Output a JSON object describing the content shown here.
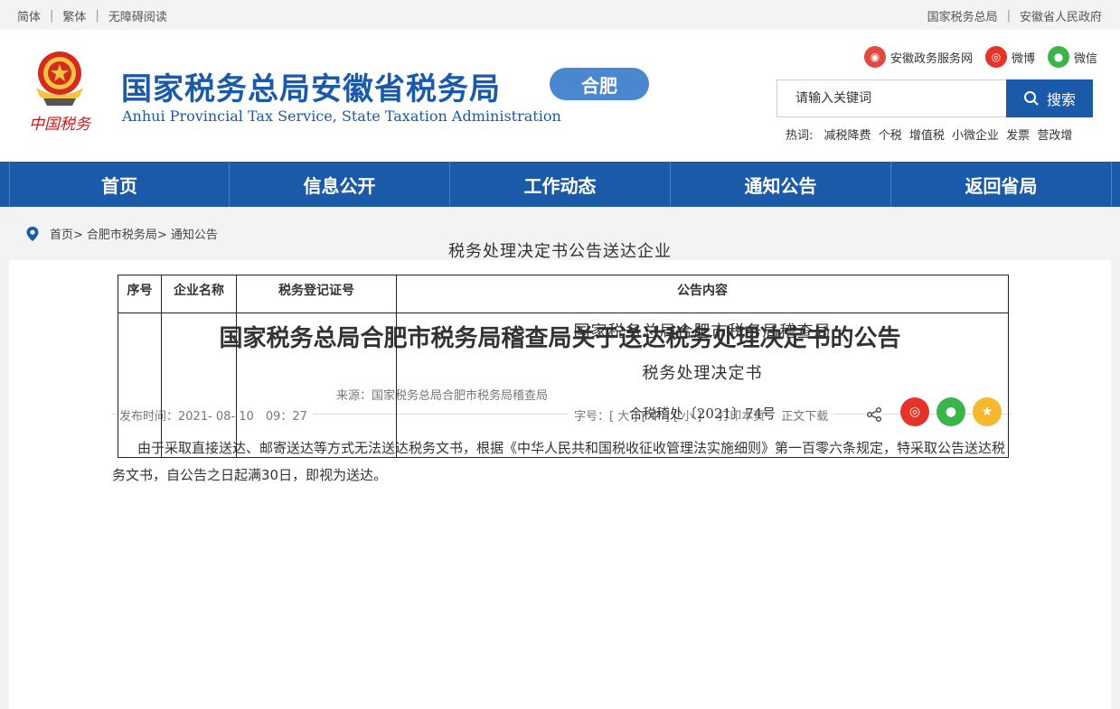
{
  "topbar": {
    "left": [
      "简体",
      "繁体",
      "无障碍阅读"
    ],
    "right": [
      "国家税务总局",
      "安徽省人民政府"
    ]
  },
  "header": {
    "logo_text": "中国税务",
    "site_name_cn": "国家税务总局安徽省税务局",
    "site_name_en": "Anhui Provincial Tax Service, State Taxation Administration",
    "city_badge": "合肥",
    "social": [
      {
        "label": "安徽政务服务网",
        "icon": "gov-service-icon",
        "color": "#e34a3f"
      },
      {
        "label": "微博",
        "icon": "weibo-icon",
        "color": "#e6332a"
      },
      {
        "label": "微信",
        "icon": "wechat-icon",
        "color": "#3bb54a"
      }
    ],
    "search": {
      "placeholder": "请输入关键词",
      "button": "搜索"
    },
    "hot_label": "热词:",
    "hot_words": [
      "减税降费",
      "个税",
      "增值税",
      "小微企业",
      "发票",
      "营改增"
    ]
  },
  "nav": [
    "首页",
    "信息公开",
    "工作动态",
    "通知公告",
    "返回省局"
  ],
  "breadcrumb": [
    "首页>",
    "合肥市税务局>",
    "通知公告"
  ],
  "article": {
    "title": "国家税务总局合肥市税务局稽查局关于送达税务处理决定书的公告",
    "source": "来源：国家税务总局合肥市税务局稽查局",
    "publish_time": "发布时间：2021- 08- 10　09：27",
    "font_size_label": "字号：",
    "font_sizes": [
      "[ 大 ]",
      "[ 中 ]",
      "[ 小 ]"
    ],
    "print": "打印本页",
    "download": "正文下载",
    "share_colors": {
      "weibo": "#e6332a",
      "wechat": "#3bb54a",
      "favorite": "#f5b82e"
    },
    "paragraph": "由于采取直接送达、邮寄送达等方式无法送达税务文书，根据《中华人民共和国税收征收管理法实施细则》第一百零六条规定，特采取公告送达税务文书，自公告之日起满30日，即视为送达。",
    "table_title": "税务处理决定书公告送达企业",
    "table_headers": [
      "序号",
      "企业名称",
      "税务登记证号",
      "公告内容"
    ],
    "doc_lines": [
      "国家税务总局合肥市税务局稽查局",
      "税务处理决定书",
      "合税稽处〔2021〕74号"
    ]
  }
}
